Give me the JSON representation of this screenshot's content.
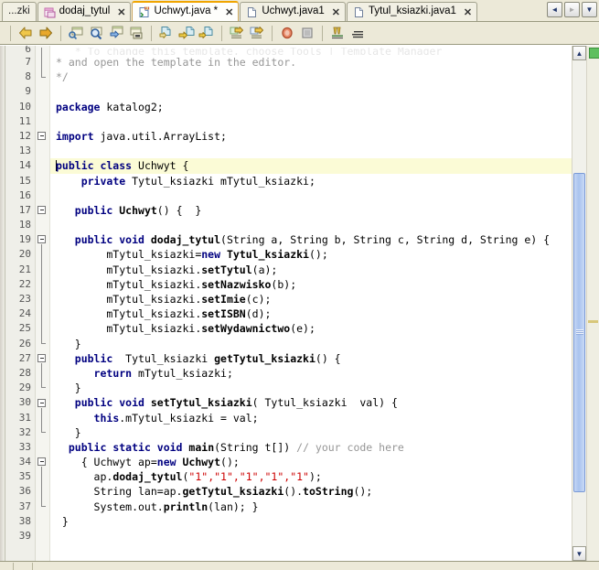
{
  "window": {
    "kind": "java-ide-editor"
  },
  "tabs": [
    {
      "label": "...zki",
      "icon": "none",
      "closable": false,
      "active": false,
      "modified": false
    },
    {
      "label": "dodaj_tytul",
      "icon": "form-icon",
      "closable": true,
      "active": false,
      "modified": false
    },
    {
      "label": "Uchwyt.java *",
      "icon": "java-class-icon",
      "closable": true,
      "active": true,
      "modified": true
    },
    {
      "label": "Uchwyt.java1",
      "icon": "file-icon",
      "closable": true,
      "active": false,
      "modified": false
    },
    {
      "label": "Tytul_ksiazki.java1",
      "icon": "file-icon",
      "closable": true,
      "active": false,
      "modified": false
    }
  ],
  "tab_nav": {
    "prev_label": "◄",
    "next_label": "►",
    "list_label": "▼"
  },
  "toolbar": {
    "groups": [
      {
        "items": [
          {
            "name": "back-icon",
            "label": "Back"
          },
          {
            "name": "forward-icon",
            "label": "Forward"
          }
        ]
      },
      {
        "items": [
          {
            "name": "find-selection-icon",
            "label": "Find Selection"
          },
          {
            "name": "find-icon",
            "label": "Find"
          },
          {
            "name": "find-next-icon",
            "label": "Find Next"
          },
          {
            "name": "toggle-rectangular-selection-icon",
            "label": "Toggle Rectangular Selection"
          }
        ]
      },
      {
        "items": [
          {
            "name": "last-edit-icon",
            "label": "Last Edit"
          },
          {
            "name": "previous-bookmark-icon",
            "label": "Previous Bookmark"
          },
          {
            "name": "next-bookmark-icon",
            "label": "Next Bookmark"
          }
        ]
      },
      {
        "items": [
          {
            "name": "shift-line-left-icon",
            "label": "Shift Line Left"
          },
          {
            "name": "shift-line-right-icon",
            "label": "Shift Line Right"
          }
        ]
      },
      {
        "items": [
          {
            "name": "comment-icon",
            "label": "Comment"
          },
          {
            "name": "uncomment-icon",
            "label": "Uncomment"
          }
        ]
      },
      {
        "items": [
          {
            "name": "toggle-breakpoint-icon",
            "label": "Toggle Breakpoint"
          },
          {
            "name": "stop-icon",
            "label": "Stop"
          }
        ]
      },
      {
        "items": [
          {
            "name": "toggle-highlight-icon",
            "label": "Toggle Highlight Search"
          },
          {
            "name": "toggle-bookmark-icon",
            "label": "Toggle Bookmark"
          }
        ]
      }
    ]
  },
  "editor": {
    "first_visible_line": 6,
    "current_line": 14,
    "partial_top_text": "* To change this template, choose Tools | Template Manager",
    "lines": [
      {
        "n": 7,
        "indent": 1,
        "tokens": [
          {
            "t": "cmt",
            "v": "* and open the template in the editor."
          }
        ]
      },
      {
        "n": 8,
        "indent": 1,
        "tokens": [
          {
            "t": "cmt",
            "v": "*/"
          }
        ]
      },
      {
        "n": 9,
        "indent": 0,
        "tokens": []
      },
      {
        "n": 10,
        "indent": 1,
        "tokens": [
          {
            "t": "kw",
            "v": "package"
          },
          {
            "t": "plain",
            "v": " katalog2;"
          }
        ]
      },
      {
        "n": 11,
        "indent": 0,
        "tokens": []
      },
      {
        "n": 12,
        "indent": 0,
        "tokens": [
          {
            "t": "kw",
            "v": "import"
          },
          {
            "t": "plain",
            "v": " java.util.ArrayList;"
          }
        ]
      },
      {
        "n": 13,
        "indent": 0,
        "tokens": []
      },
      {
        "n": 14,
        "indent": 0,
        "tokens": [
          {
            "t": "caret",
            "v": ""
          },
          {
            "t": "kw",
            "v": "public class"
          },
          {
            "t": "plain",
            "v": " Uchwyt {"
          }
        ]
      },
      {
        "n": 15,
        "indent": 0,
        "tokens": [
          {
            "t": "plain",
            "v": "    "
          },
          {
            "t": "kw",
            "v": "private"
          },
          {
            "t": "plain",
            "v": " Tytul_ksiazki mTytul_ksiazki;"
          }
        ]
      },
      {
        "n": 16,
        "indent": 0,
        "tokens": []
      },
      {
        "n": 17,
        "indent": 0,
        "tokens": [
          {
            "t": "plain",
            "v": "   "
          },
          {
            "t": "kw",
            "v": "public "
          },
          {
            "t": "bold",
            "v": "Uchwyt"
          },
          {
            "t": "plain",
            "v": "() {  }"
          }
        ]
      },
      {
        "n": 18,
        "indent": 0,
        "tokens": []
      },
      {
        "n": 19,
        "indent": 0,
        "tokens": [
          {
            "t": "plain",
            "v": "   "
          },
          {
            "t": "kw",
            "v": "public void "
          },
          {
            "t": "bold",
            "v": "dodaj_tytul"
          },
          {
            "t": "plain",
            "v": "(String a, String b, String c, String d, String e) {"
          }
        ]
      },
      {
        "n": 20,
        "indent": 0,
        "tokens": [
          {
            "t": "plain",
            "v": "        mTytul_ksiazki="
          },
          {
            "t": "kw",
            "v": "new "
          },
          {
            "t": "bold",
            "v": "Tytul_ksiazki"
          },
          {
            "t": "plain",
            "v": "();"
          }
        ]
      },
      {
        "n": 21,
        "indent": 0,
        "tokens": [
          {
            "t": "plain",
            "v": "        mTytul_ksiazki."
          },
          {
            "t": "bold",
            "v": "setTytul"
          },
          {
            "t": "plain",
            "v": "(a);"
          }
        ]
      },
      {
        "n": 22,
        "indent": 0,
        "tokens": [
          {
            "t": "plain",
            "v": "        mTytul_ksiazki."
          },
          {
            "t": "bold",
            "v": "setNazwisko"
          },
          {
            "t": "plain",
            "v": "(b);"
          }
        ]
      },
      {
        "n": 23,
        "indent": 0,
        "tokens": [
          {
            "t": "plain",
            "v": "        mTytul_ksiazki."
          },
          {
            "t": "bold",
            "v": "setImie"
          },
          {
            "t": "plain",
            "v": "(c);"
          }
        ]
      },
      {
        "n": 24,
        "indent": 0,
        "tokens": [
          {
            "t": "plain",
            "v": "        mTytul_ksiazki."
          },
          {
            "t": "bold",
            "v": "setISBN"
          },
          {
            "t": "plain",
            "v": "(d);"
          }
        ]
      },
      {
        "n": 25,
        "indent": 0,
        "tokens": [
          {
            "t": "plain",
            "v": "        mTytul_ksiazki."
          },
          {
            "t": "bold",
            "v": "setWydawnictwo"
          },
          {
            "t": "plain",
            "v": "(e);"
          }
        ]
      },
      {
        "n": 26,
        "indent": 0,
        "tokens": [
          {
            "t": "plain",
            "v": "   }"
          }
        ]
      },
      {
        "n": 27,
        "indent": 0,
        "tokens": [
          {
            "t": "plain",
            "v": "   "
          },
          {
            "t": "kw",
            "v": "public "
          },
          {
            "t": "plain",
            "v": " Tytul_ksiazki "
          },
          {
            "t": "bold",
            "v": "getTytul_ksiazki"
          },
          {
            "t": "plain",
            "v": "() {"
          }
        ]
      },
      {
        "n": 28,
        "indent": 0,
        "tokens": [
          {
            "t": "plain",
            "v": "      "
          },
          {
            "t": "kw",
            "v": "return"
          },
          {
            "t": "plain",
            "v": " mTytul_ksiazki;"
          }
        ]
      },
      {
        "n": 29,
        "indent": 0,
        "tokens": [
          {
            "t": "plain",
            "v": "   }"
          }
        ]
      },
      {
        "n": 30,
        "indent": 0,
        "tokens": [
          {
            "t": "plain",
            "v": "   "
          },
          {
            "t": "kw",
            "v": "public void "
          },
          {
            "t": "bold",
            "v": "setTytul_ksiazki"
          },
          {
            "t": "plain",
            "v": "( Tytul_ksiazki  val) {"
          }
        ]
      },
      {
        "n": 31,
        "indent": 0,
        "tokens": [
          {
            "t": "plain",
            "v": "      "
          },
          {
            "t": "kw",
            "v": "this"
          },
          {
            "t": "plain",
            "v": ".mTytul_ksiazki = val;"
          }
        ]
      },
      {
        "n": 32,
        "indent": 0,
        "tokens": [
          {
            "t": "plain",
            "v": "   }"
          }
        ]
      },
      {
        "n": 33,
        "indent": 0,
        "tokens": [
          {
            "t": "plain",
            "v": "  "
          },
          {
            "t": "kw",
            "v": "public static void "
          },
          {
            "t": "bold",
            "v": "main"
          },
          {
            "t": "plain",
            "v": "(String t[]) "
          },
          {
            "t": "cmt",
            "v": "// your code here"
          }
        ]
      },
      {
        "n": 34,
        "indent": 0,
        "tokens": [
          {
            "t": "plain",
            "v": "    { Uchwyt ap="
          },
          {
            "t": "kw",
            "v": "new "
          },
          {
            "t": "bold",
            "v": "Uchwyt"
          },
          {
            "t": "plain",
            "v": "();"
          }
        ]
      },
      {
        "n": 35,
        "indent": 0,
        "tokens": [
          {
            "t": "plain",
            "v": "      ap."
          },
          {
            "t": "bold",
            "v": "dodaj_tytul"
          },
          {
            "t": "plain",
            "v": "("
          },
          {
            "t": "str",
            "v": "\"1\",\"1\",\"1\",\"1\",\"1\""
          },
          {
            "t": "plain",
            "v": ");"
          }
        ]
      },
      {
        "n": 36,
        "indent": 0,
        "tokens": [
          {
            "t": "plain",
            "v": "      String lan=ap."
          },
          {
            "t": "bold",
            "v": "getTytul_ksiazki"
          },
          {
            "t": "plain",
            "v": "()."
          },
          {
            "t": "bold",
            "v": "toString"
          },
          {
            "t": "plain",
            "v": "();"
          }
        ]
      },
      {
        "n": 37,
        "indent": 0,
        "tokens": [
          {
            "t": "plain",
            "v": "      System.out."
          },
          {
            "t": "bold",
            "v": "println"
          },
          {
            "t": "plain",
            "v": "(lan); }"
          }
        ]
      },
      {
        "n": 38,
        "indent": 0,
        "tokens": [
          {
            "t": "plain",
            "v": " }"
          }
        ]
      },
      {
        "n": 39,
        "indent": 0,
        "tokens": []
      }
    ],
    "fold_markers": [
      12,
      17,
      19,
      27,
      30,
      34
    ],
    "colors": {
      "keyword": "#000080",
      "comment": "#969696",
      "string": "#cc0000",
      "current_line_bg": "#fbfbd6",
      "editor_bg": "#ffffff",
      "gutter_bg": "#efefe9",
      "chrome_bg": "#ece9d8",
      "active_tab_accent": "#f0a500",
      "scrollbar_thumb": "#a9c3ee",
      "annotation_ok": "#5fbf5f"
    }
  },
  "scrollbar": {
    "up_arrow": "▲",
    "down_arrow": "▼",
    "thumb_top_pct": 23,
    "thumb_height_pct": 66
  }
}
